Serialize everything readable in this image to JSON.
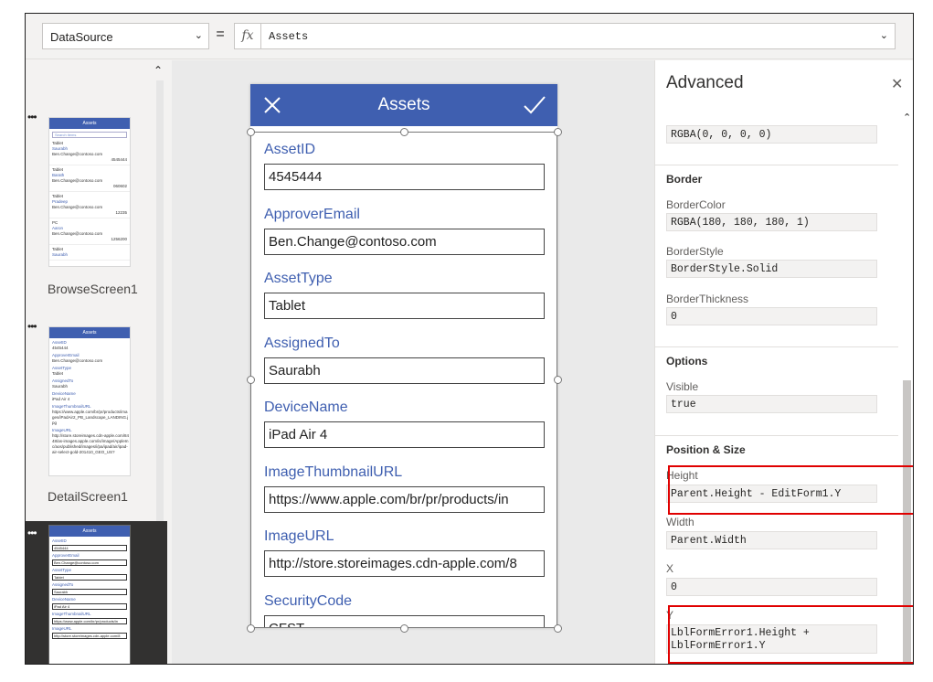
{
  "formula_bar": {
    "property": "DataSource",
    "equals": "=",
    "fx": "fx",
    "formula": "Assets"
  },
  "screens": {
    "browse": {
      "name": "BrowseScreen1",
      "thumb_title": "Assets",
      "search_placeholder": "Search items",
      "items": [
        {
          "title": "Tablet",
          "sub": "Saurabh",
          "email": "Ben.Change@contoso.com",
          "code": "4545444"
        },
        {
          "title": "Tablet",
          "sub": "Barath",
          "email": "Ben.Change@contoso.com",
          "code": "060602"
        },
        {
          "title": "Tablet",
          "sub": "Pradeep",
          "email": "Ben.Change@contoso.com",
          "code": "12235"
        },
        {
          "title": "PC",
          "sub": "Aaron",
          "email": "Ben.Change@contoso.com",
          "code": "1256200"
        },
        {
          "title": "Tablet",
          "sub": "Saurabh",
          "email": "",
          "code": ""
        }
      ]
    },
    "detail": {
      "name": "DetailScreen1",
      "thumb_title": "Assets",
      "lines": [
        {
          "label": "AssetID",
          "value": "4545444"
        },
        {
          "label": "ApproverEmail",
          "value": "Ben.Change@contoso.com"
        },
        {
          "label": "AssetType",
          "value": "Tablet"
        },
        {
          "label": "AssignedTo",
          "value": "Saurabh"
        },
        {
          "label": "DeviceName",
          "value": "iPad Air 4"
        },
        {
          "label": "ImageThumbnailURL",
          "value": "https://www.apple.com/br/pr/products/images/iPadAir2_PB_Landscape_LANDING.jpg"
        },
        {
          "label": "ImageURL",
          "value": "http://store.storeimages.cdn-apple.com/8448/as-images.apple.com/is/image/AppleInc/aos/published/images/i/pa/ipad/air/ipad-air-select-gold-201410_GEO_US?"
        }
      ]
    },
    "edit": {
      "thumb_title": "Assets",
      "lines": [
        {
          "label": "AssetID",
          "value": "4545444"
        },
        {
          "label": "ApproverEmail",
          "value": "Ben.Change@contoso.com"
        },
        {
          "label": "AssetType",
          "value": "Tablet"
        },
        {
          "label": "AssignedTo",
          "value": "Saurabh"
        },
        {
          "label": "DeviceName",
          "value": "iPad Air 4"
        },
        {
          "label": "ImageThumbnailURL",
          "value": "https://www.apple.com/br/pr/products/in"
        },
        {
          "label": "ImageURL",
          "value": "http://store.storeimages.cdn-apple.com/8"
        }
      ]
    }
  },
  "form": {
    "title": "Assets",
    "fields": [
      {
        "label": "AssetID",
        "value": "4545444"
      },
      {
        "label": "ApproverEmail",
        "value": "Ben.Change@contoso.com"
      },
      {
        "label": "AssetType",
        "value": "Tablet"
      },
      {
        "label": "AssignedTo",
        "value": "Saurabh"
      },
      {
        "label": "DeviceName",
        "value": "iPad Air 4"
      },
      {
        "label": "ImageThumbnailURL",
        "value": "https://www.apple.com/br/pr/products/in"
      },
      {
        "label": "ImageURL",
        "value": "http://store.storeimages.cdn-apple.com/8"
      },
      {
        "label": "SecurityCode",
        "value": "CFST"
      }
    ]
  },
  "advanced": {
    "title": "Advanced",
    "fill_value": "RGBA(0, 0, 0, 0)",
    "border_section": "Border",
    "border_color_label": "BorderColor",
    "border_color_value": "RGBA(180, 180, 180, 1)",
    "border_style_label": "BorderStyle",
    "border_style_value": "BorderStyle.Solid",
    "border_thickness_label": "BorderThickness",
    "border_thickness_value": "0",
    "options_section": "Options",
    "visible_label": "Visible",
    "visible_value": "true",
    "position_section": "Position & Size",
    "height_label": "Height",
    "height_value": "Parent.Height - EditForm1.Y",
    "width_label": "Width",
    "width_value": "Parent.Width",
    "x_label": "X",
    "x_value": "0",
    "y_label": "Y",
    "y_value": "LblFormError1.Height + LblFormError1.Y"
  },
  "colors": {
    "accent": "#3f5fb0",
    "highlight": "#e00000"
  }
}
